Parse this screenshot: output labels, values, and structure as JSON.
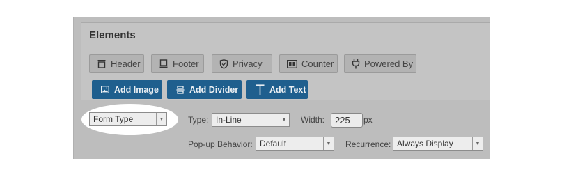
{
  "elements": {
    "title": "Elements",
    "buttons": [
      {
        "label": "Header",
        "icon": "header-icon"
      },
      {
        "label": "Footer",
        "icon": "footer-icon"
      },
      {
        "label": "Privacy",
        "icon": "shield-icon"
      },
      {
        "label": "Counter",
        "icon": "counter-icon"
      },
      {
        "label": "Powered By",
        "icon": "plug-icon"
      }
    ],
    "actions": [
      {
        "label": "Add Image",
        "icon": "image-icon"
      },
      {
        "label": "Add Divider",
        "icon": "divider-icon"
      },
      {
        "label": "Add Text",
        "icon": "text-icon"
      }
    ]
  },
  "settings": {
    "form_type": {
      "value": "Form Type"
    },
    "type": {
      "label": "Type:",
      "value": "In-Line"
    },
    "width": {
      "label": "Width:",
      "value": "225",
      "unit": "px"
    },
    "popup": {
      "label": "Pop-up Behavior:",
      "value": "Default"
    },
    "recurrence": {
      "label": "Recurrence:",
      "value": "Always Display"
    }
  },
  "colors": {
    "panel": "#bdbdbd",
    "action_button": "#1f5f8e",
    "highlight": "#ffffff"
  }
}
